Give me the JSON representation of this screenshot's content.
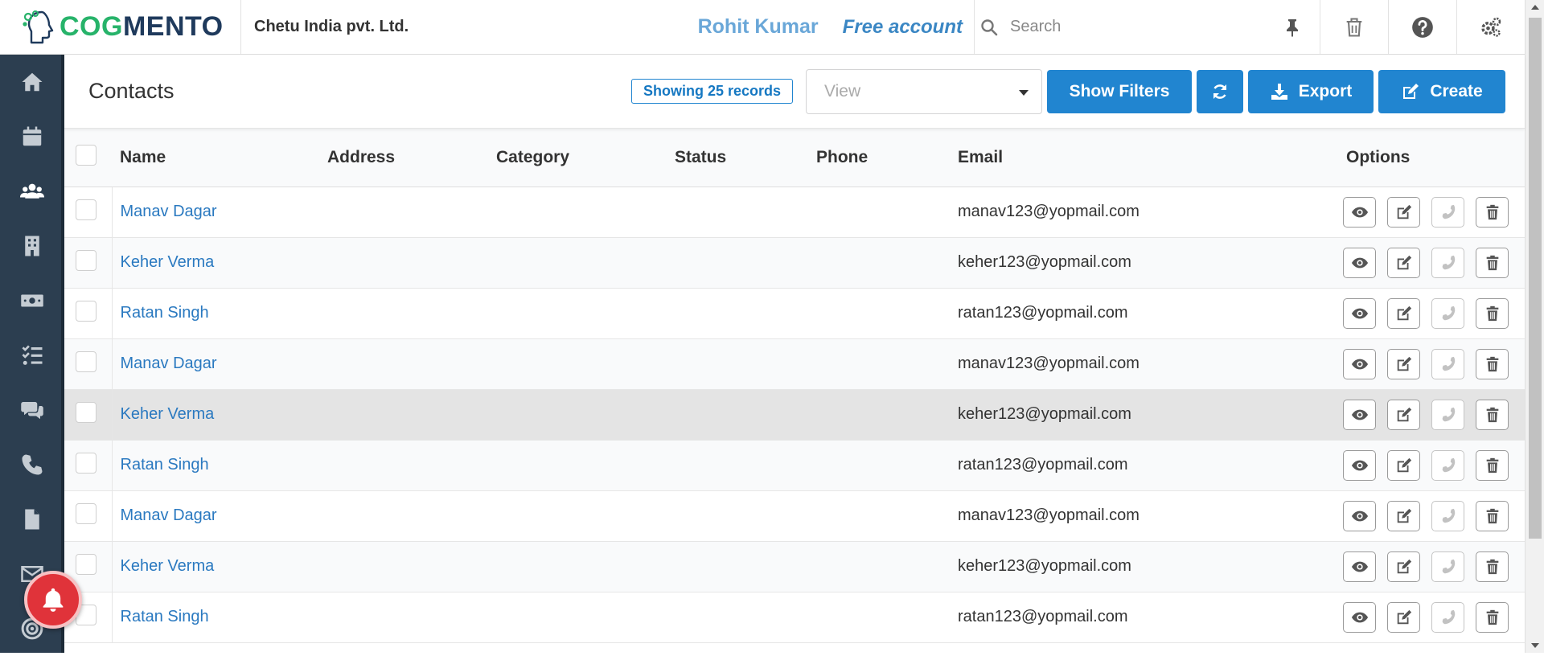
{
  "header": {
    "logo_text_part1": "COG",
    "logo_text_part2": "MENTO",
    "company": "Chetu India pvt. Ltd.",
    "user_name": "Rohit Kumar",
    "account_type": "Free account",
    "search_placeholder": "Search",
    "icons": [
      "search-icon",
      "pin-icon",
      "trash-icon",
      "help-icon",
      "settings-icon"
    ]
  },
  "sidebar": {
    "items": [
      {
        "icon": "home-icon"
      },
      {
        "icon": "calendar-icon"
      },
      {
        "icon": "contacts-icon",
        "active": true
      },
      {
        "icon": "companies-icon"
      },
      {
        "icon": "deals-icon"
      },
      {
        "icon": "tasks-icon"
      },
      {
        "icon": "cases-icon"
      },
      {
        "icon": "calls-icon"
      },
      {
        "icon": "documents-icon"
      },
      {
        "icon": "email-icon"
      },
      {
        "icon": "campaigns-icon"
      }
    ]
  },
  "toolbar": {
    "title": "Contacts",
    "records_badge": "Showing 25 records",
    "view_placeholder": "View",
    "show_filters": "Show Filters",
    "export": "Export",
    "create": "Create"
  },
  "table": {
    "columns": {
      "name": "Name",
      "address": "Address",
      "category": "Category",
      "status": "Status",
      "phone": "Phone",
      "email": "Email",
      "options": "Options"
    },
    "rows": [
      {
        "name": "Manav Dagar",
        "address": "",
        "category": "",
        "status": "",
        "phone": "",
        "email": "manav123@yopmail.com"
      },
      {
        "name": "Keher Verma",
        "address": "",
        "category": "",
        "status": "",
        "phone": "",
        "email": "keher123@yopmail.com"
      },
      {
        "name": "Ratan Singh",
        "address": "",
        "category": "",
        "status": "",
        "phone": "",
        "email": "ratan123@yopmail.com"
      },
      {
        "name": "Manav Dagar",
        "address": "",
        "category": "",
        "status": "",
        "phone": "",
        "email": "manav123@yopmail.com"
      },
      {
        "name": "Keher Verma",
        "address": "",
        "category": "",
        "status": "",
        "phone": "",
        "email": "keher123@yopmail.com"
      },
      {
        "name": "Ratan Singh",
        "address": "",
        "category": "",
        "status": "",
        "phone": "",
        "email": "ratan123@yopmail.com"
      },
      {
        "name": "Manav Dagar",
        "address": "",
        "category": "",
        "status": "",
        "phone": "",
        "email": "manav123@yopmail.com"
      },
      {
        "name": "Keher Verma",
        "address": "",
        "category": "",
        "status": "",
        "phone": "",
        "email": "keher123@yopmail.com"
      },
      {
        "name": "Ratan Singh",
        "address": "",
        "category": "",
        "status": "",
        "phone": "",
        "email": "ratan123@yopmail.com"
      }
    ],
    "hovered_row": 4,
    "row_options": [
      "view-icon",
      "edit-icon",
      "call-icon",
      "delete-icon"
    ]
  },
  "colors": {
    "primary": "#2185d0",
    "sidebar": "#2c3e50",
    "logo_green": "#27b36a",
    "logo_navy": "#1f3a5c",
    "link": "#2a79c0",
    "notification": "#e0333a"
  }
}
